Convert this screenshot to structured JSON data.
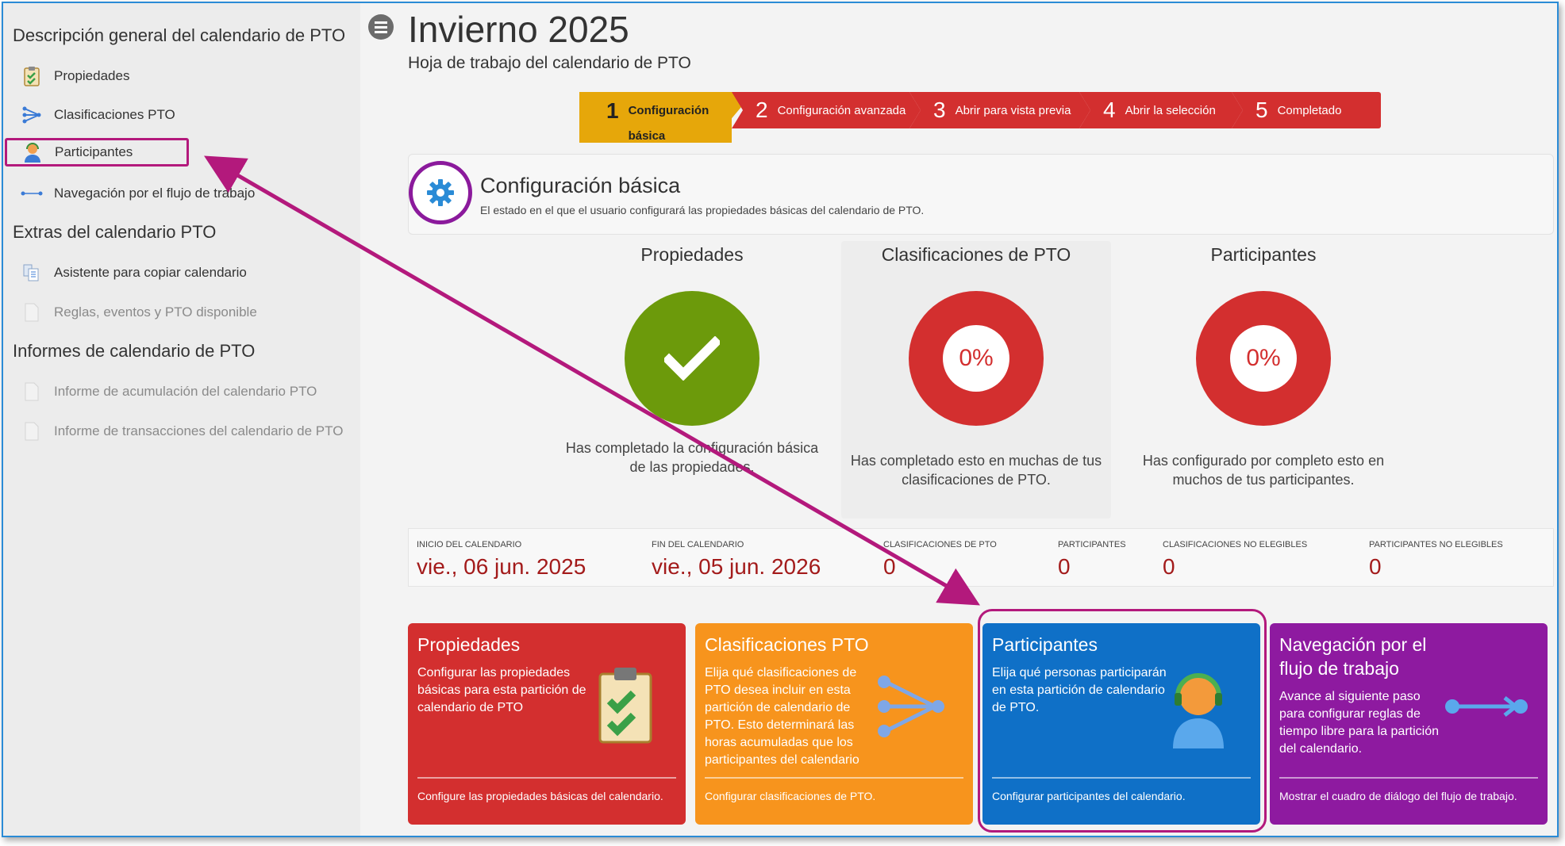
{
  "sidebar": {
    "sections": [
      {
        "title": "Descripción general del calendario de PTO"
      },
      {
        "title": "Extras del calendario PTO"
      },
      {
        "title": "Informes de calendario de PTO"
      }
    ],
    "items": [
      {
        "label": "Propiedades",
        "icon": "clipboard-check-icon"
      },
      {
        "label": "Clasificaciones PTO",
        "icon": "branch-arrow-icon"
      },
      {
        "label": "Participantes",
        "icon": "person-headset-icon"
      },
      {
        "label": "Navegación por el flujo de trabajo",
        "icon": "workflow-arrow-icon"
      },
      {
        "label": "Asistente para copiar calendario",
        "icon": "copy-calendar-icon"
      },
      {
        "label": "Reglas, eventos y PTO disponible",
        "icon": "document-icon"
      },
      {
        "label": "Informe de acumulación del calendario PTO",
        "icon": "document-icon"
      },
      {
        "label": "Informe de transacciones del calendario de PTO",
        "icon": "document-icon"
      }
    ]
  },
  "header": {
    "title": "Invierno 2025",
    "subtitle": "Hoja de trabajo del calendario de PTO"
  },
  "steps": [
    {
      "num": "1",
      "label": "Configuración básica",
      "active": true
    },
    {
      "num": "2",
      "label": "Configuración avanzada"
    },
    {
      "num": "3",
      "label": "Abrir para vista previa"
    },
    {
      "num": "4",
      "label": "Abrir la selección"
    },
    {
      "num": "5",
      "label": "Completado"
    }
  ],
  "config": {
    "title": "Configuración básica",
    "description": "El estado en el que el usuario configurará las propiedades básicas del calendario de PTO."
  },
  "status": [
    {
      "title": "Propiedades",
      "state": "complete",
      "text": "Has completado la configuración básica de las propiedades."
    },
    {
      "title": "Clasificaciones de PTO",
      "percent": "0%",
      "text": "Has completado esto en muchas de tus clasificaciones de PTO."
    },
    {
      "title": "Participantes",
      "percent": "0%",
      "text": "Has configurado por completo esto en muchos de tus participantes."
    }
  ],
  "info": [
    {
      "label": "Inicio del calendario",
      "value": "vie., 06 jun. 2025"
    },
    {
      "label": "Fin del calendario",
      "value": "vie., 05 jun. 2026"
    },
    {
      "label": "Clasificaciones de PTO",
      "value": "0"
    },
    {
      "label": "Participantes",
      "value": "0"
    },
    {
      "label": "Clasificaciones no elegibles",
      "value": "0"
    },
    {
      "label": "Participantes no elegibles",
      "value": "0"
    }
  ],
  "tiles": [
    {
      "title": "Propiedades",
      "desc": "Configurar las propiedades básicas para esta partición de calendario de PTO",
      "link": "Configure las propiedades básicas del calendario.",
      "icon": "clipboard-check-icon"
    },
    {
      "title": "Clasificaciones PTO",
      "desc": "Elija qué clasificaciones de PTO desea incluir en esta partición de calendario de PTO. Esto determinará las horas acumuladas que los participantes del calendario",
      "link": "Configurar clasificaciones de PTO.",
      "icon": "branch-arrow-icon"
    },
    {
      "title": "Participantes",
      "desc": "Elija qué personas participarán en esta partición de calendario de PTO.",
      "link": "Configurar participantes del calendario.",
      "icon": "person-headset-icon"
    },
    {
      "title": "Navegación por el flujo de trabajo",
      "desc": "Avance al siguiente paso para configurar reglas de tiempo libre para la partición del calendario.",
      "link": "Mostrar el cuadro de diálogo del flujo de trabajo.",
      "icon": "workflow-arrow-icon"
    }
  ],
  "colors": {
    "accent_red": "#d32f2f",
    "step_active": "#e6a70a",
    "tile_orange": "#f7941d",
    "tile_blue": "#0f70c7",
    "tile_purple": "#8e1aa0",
    "complete_green": "#6c9a0b",
    "annotation_magenta": "#b3197c"
  }
}
